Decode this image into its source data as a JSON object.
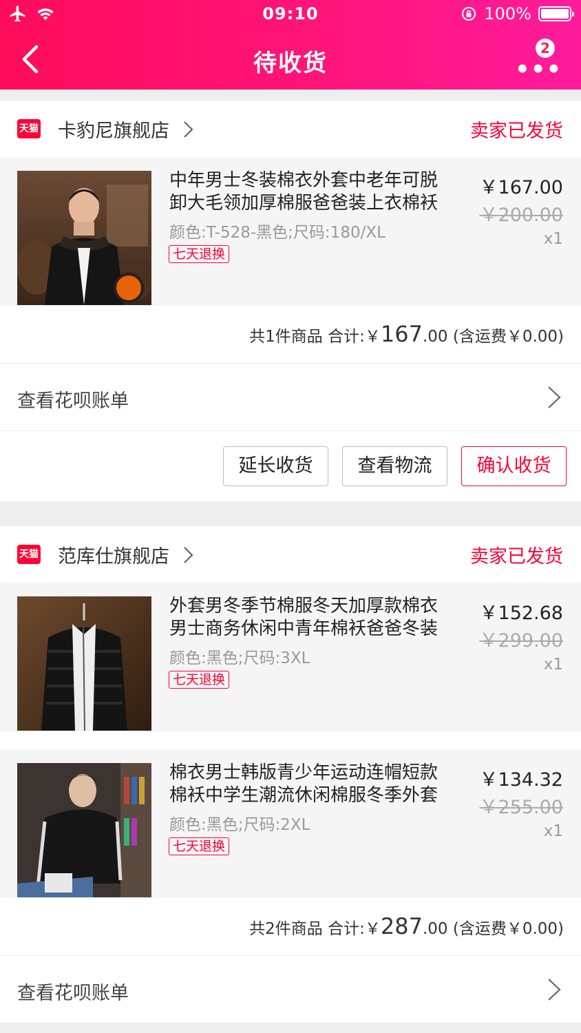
{
  "status_bar": {
    "time": "09:10",
    "battery": "100%"
  },
  "nav": {
    "title": "待收货",
    "more_badge": "2"
  },
  "orders": [
    {
      "shop_name": "卡豹尼旗舰店",
      "shop_badge": "天猫",
      "status": "卖家已发货",
      "items": [
        {
          "title": "中年男士冬装棉衣外套中老年可脱卸大毛领加厚棉服爸爸装上衣棉袄",
          "sku": "颜色:T-528-黑色;尺码:180/XL",
          "tag": "七天退换",
          "price": "￥167.00",
          "original_price": "￥200.00",
          "quantity": "x1"
        }
      ],
      "summary": {
        "prefix": "共1件商品 合计:￥",
        "big": "167",
        "suffix": ".00 (含运费￥0.00)"
      },
      "bill_label": "查看花呗账单",
      "actions": [
        "延长收货",
        "查看物流",
        "确认收货"
      ]
    },
    {
      "shop_name": "范库仕旗舰店",
      "shop_badge": "天猫",
      "status": "卖家已发货",
      "items": [
        {
          "title": "外套男冬季节棉服冬天加厚款棉衣男士商务休闲中青年棉袄爸爸冬装",
          "sku": "颜色:黑色;尺码:3XL",
          "tag": "七天退换",
          "price": "￥152.68",
          "original_price": "￥299.00",
          "quantity": "x1"
        },
        {
          "title": "棉衣男士韩版青少年运动连帽短款棉袄中学生潮流休闲棉服冬季外套",
          "sku": "颜色:黑色;尺码:2XL",
          "tag": "七天退换",
          "price": "￥134.32",
          "original_price": "￥255.00",
          "quantity": "x1"
        }
      ],
      "summary": {
        "prefix": "共2件商品 合计:￥",
        "big": "287",
        "suffix": ".00 (含运费￥0.00)"
      },
      "bill_label": "查看花呗账单"
    }
  ]
}
